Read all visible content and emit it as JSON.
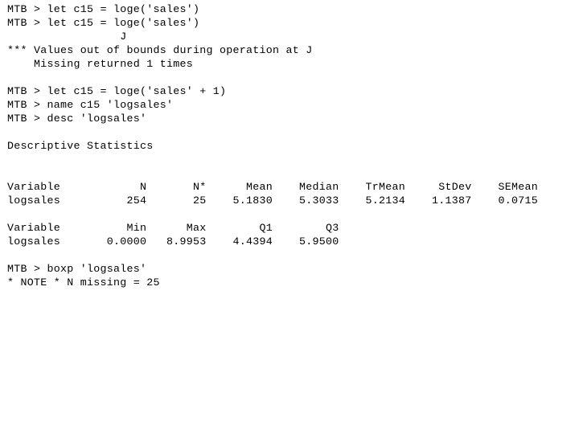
{
  "window": {
    "app_name": "Minitab",
    "pane_title": "Session",
    "background_color": "#ffffff",
    "text_color": "#000000"
  },
  "session": {
    "prompt": "MTB >",
    "lines": [
      "MTB > let c15 = loge('sales')",
      "MTB > let c15 = loge('sales')",
      "                 J",
      "*** Values out of bounds during operation at J",
      "    Missing returned 1 times",
      "",
      "MTB > let c15 = loge('sales' + 1)",
      "MTB > name c15 'logsales'",
      "MTB > desc 'logsales'",
      "",
      "Descriptive Statistics",
      "",
      "",
      "Variable            N       N*      Mean    Median    TrMean     StDev    SEMean",
      "logsales          254       25    5.1830    5.3033    5.2134    1.1387    0.0715",
      "",
      "Variable          Min      Max        Q1        Q3",
      "logsales       0.0000   8.9953    4.4394    5.9500",
      "",
      "MTB > boxp 'logsales'",
      "* NOTE * N missing = 25"
    ],
    "commands": [
      {
        "text": "let c15 = loge('sales')"
      },
      {
        "text": "let c15 = loge('sales')"
      },
      {
        "text": "let c15 = loge('sales' + 1)"
      },
      {
        "text": "name c15 'logsales'"
      },
      {
        "text": "desc 'logsales'"
      },
      {
        "text": "boxp 'logsales'"
      }
    ],
    "error_marker": "J",
    "error_message": "*** Values out of bounds during operation at J",
    "error_detail": "Missing returned 1 times",
    "note_message": "* NOTE * N missing = 25",
    "heading": "Descriptive Statistics"
  },
  "chart_data": {
    "type": "table",
    "title": "Descriptive Statistics",
    "variable_label": "Variable",
    "variable_name": "logsales",
    "blocks": [
      {
        "headers": [
          "Variable",
          "N",
          "N*",
          "Mean",
          "Median",
          "TrMean",
          "StDev",
          "SEMean"
        ],
        "rows": [
          [
            "logsales",
            "254",
            "25",
            "5.1830",
            "5.3033",
            "5.2134",
            "1.1387",
            "0.0715"
          ]
        ]
      },
      {
        "headers": [
          "Variable",
          "Min",
          "Max",
          "Q1",
          "Q3"
        ],
        "rows": [
          [
            "logsales",
            "0.0000",
            "8.9953",
            "4.4394",
            "5.9500"
          ]
        ]
      }
    ],
    "values": {
      "N": 254,
      "N_star": 25,
      "Mean": 5.183,
      "Median": 5.3033,
      "TrMean": 5.2134,
      "StDev": 1.1387,
      "SEMean": 0.0715,
      "Min": 0.0,
      "Max": 8.9953,
      "Q1": 4.4394,
      "Q3": 5.95
    }
  }
}
